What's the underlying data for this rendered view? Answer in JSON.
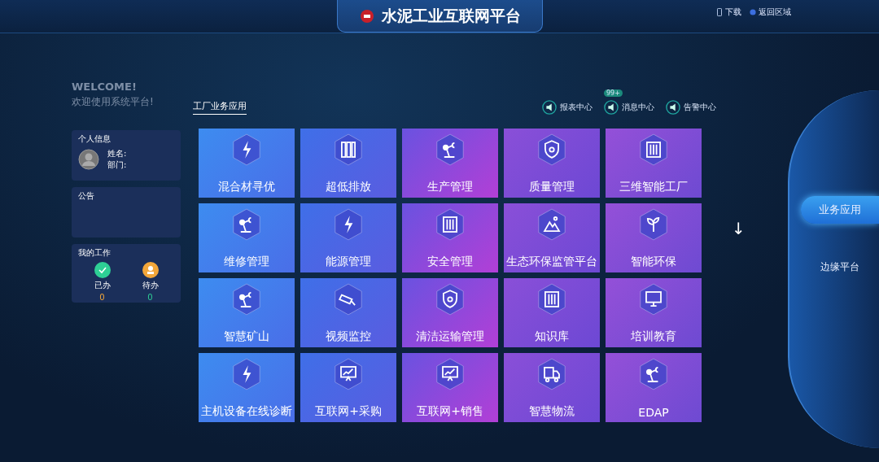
{
  "header": {
    "title": "水泥工业互联网平台",
    "links": [
      {
        "kind": "phone",
        "label": "下载"
      },
      {
        "kind": "circle",
        "label": "返回区域"
      }
    ]
  },
  "welcome": {
    "line1": "WELCOME!",
    "line2": "欢迎使用系统平台!"
  },
  "profile": {
    "title": "个人信息",
    "fields": [
      "姓名:",
      "部门:"
    ]
  },
  "notice": {
    "title": "公告"
  },
  "work": {
    "title": "我的工作",
    "items": [
      {
        "kind": "done",
        "label": "已办",
        "count": "0",
        "color": "#2ecf95"
      },
      {
        "kind": "todo",
        "label": "待办",
        "count": "0",
        "color": "#f3a73a"
      }
    ]
  },
  "section_tabs": [
    {
      "label": "工厂业务应用",
      "selected": true
    }
  ],
  "centers": [
    {
      "label": "报表中心"
    },
    {
      "label": "消息中心",
      "badge": "99+"
    },
    {
      "label": "告警中心"
    }
  ],
  "tiles": [
    {
      "label": "混合材寻优",
      "kind": "bolt"
    },
    {
      "label": "超低排放",
      "kind": "panels"
    },
    {
      "label": "生产管理",
      "kind": "robot"
    },
    {
      "label": "质量管理",
      "kind": "shield"
    },
    {
      "label": "三维智能工厂",
      "kind": "sliders"
    },
    {
      "label": "维修管理",
      "kind": "robot"
    },
    {
      "label": "能源管理",
      "kind": "bolt"
    },
    {
      "label": "安全管理",
      "kind": "sliders"
    },
    {
      "label": "生态环保监管平台",
      "kind": "mountain"
    },
    {
      "label": "智能环保",
      "kind": "sprout"
    },
    {
      "label": "智慧矿山",
      "kind": "robot"
    },
    {
      "label": "视频监控",
      "kind": "camera"
    },
    {
      "label": "清洁运输管理",
      "kind": "shield"
    },
    {
      "label": "知识库",
      "kind": "sliders"
    },
    {
      "label": "培训教育",
      "kind": "monitor"
    },
    {
      "label": "主机设备在线诊断",
      "kind": "bolt"
    },
    {
      "label": "互联网+采购",
      "kind": "chart"
    },
    {
      "label": "互联网+销售",
      "kind": "chart"
    },
    {
      "label": "智慧物流",
      "kind": "truck"
    },
    {
      "label": "EDAP",
      "kind": "robot"
    }
  ],
  "scroll_hint": "↓",
  "side_menu": [
    {
      "label": "业务应用",
      "selected": true
    },
    {
      "label": "边缘平台",
      "selected": false
    }
  ]
}
